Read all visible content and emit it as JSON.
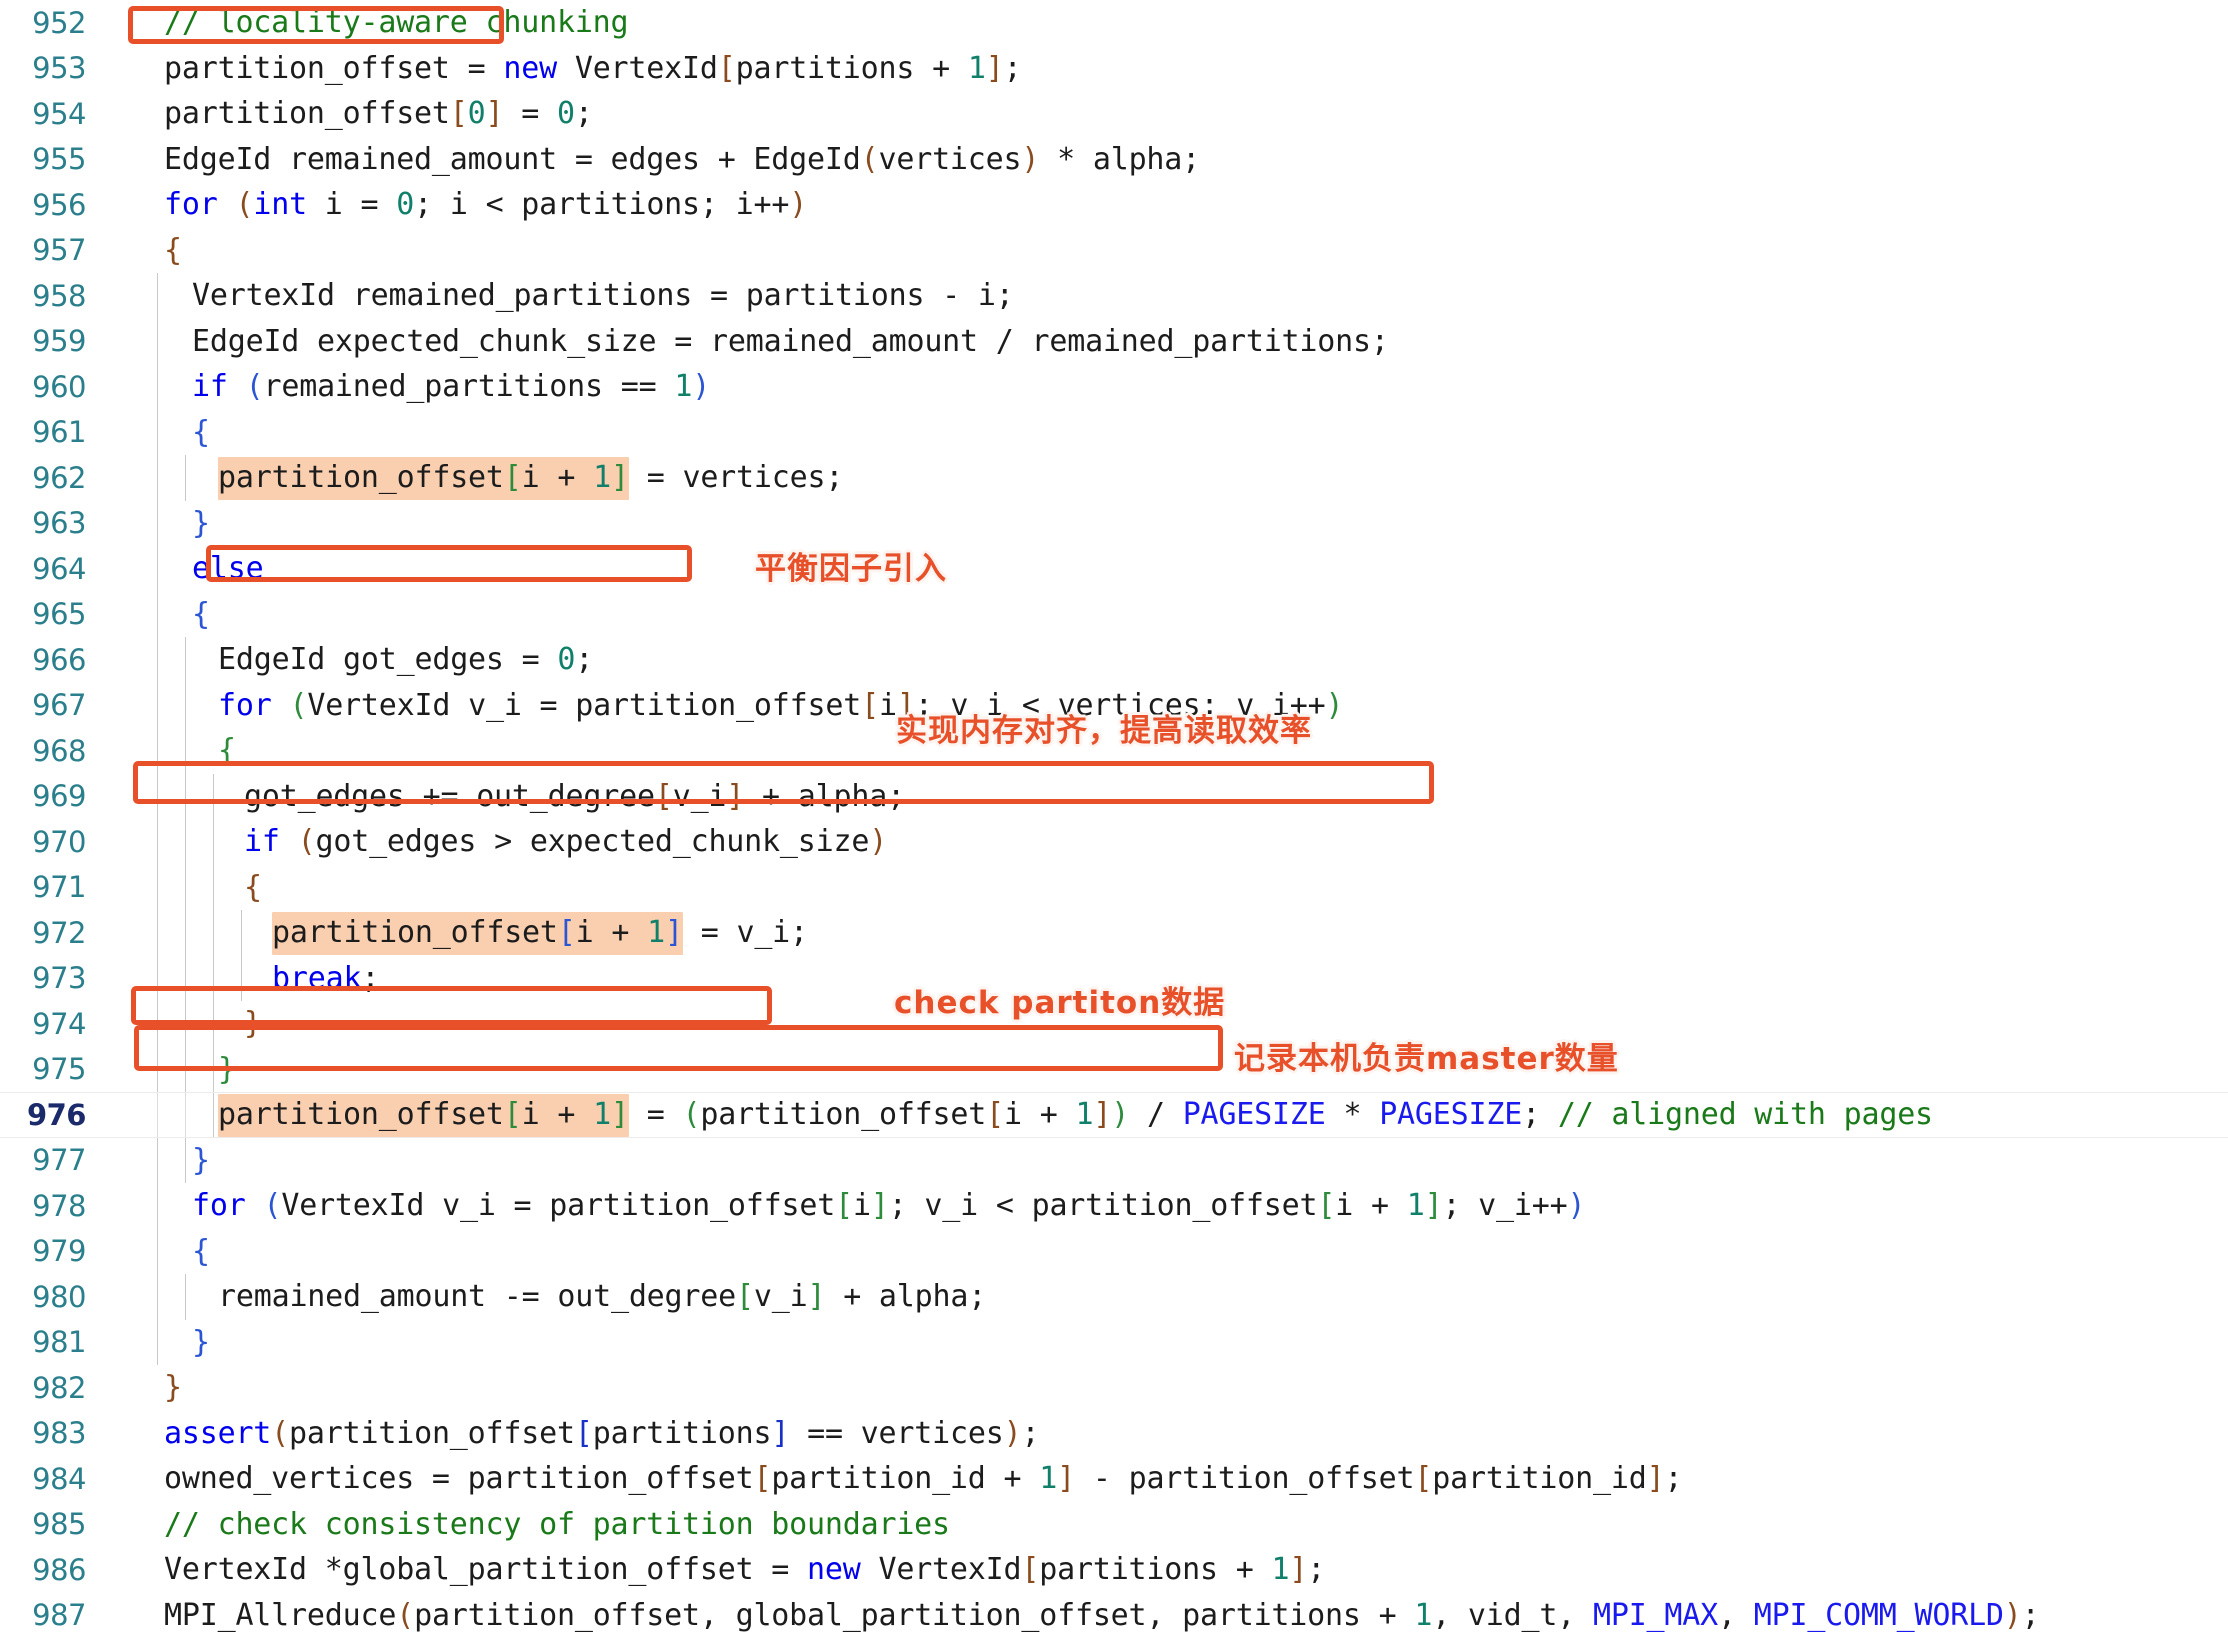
{
  "editor": {
    "language": "cpp",
    "first_line": 952,
    "last_line": 987,
    "active_line": 976,
    "colors": {
      "background": "#ffffff",
      "gutter_text": "#2b7f8c",
      "active_gutter_text": "#1b2a6b",
      "keyword": "#0000ee",
      "comment": "#1a7a1a",
      "number": "#11806a",
      "macro": "#1a1aee",
      "plain_text": "#1c1c1c",
      "occurrence_highlight": "#f9cfb0",
      "annotation_red": "#e8502a",
      "indent_guide": "#c8c8c8"
    }
  },
  "lines": [
    {
      "n": "952",
      "indent": 0
    },
    {
      "n": "953",
      "indent": 0
    },
    {
      "n": "954",
      "indent": 0
    },
    {
      "n": "955",
      "indent": 0
    },
    {
      "n": "956",
      "indent": 0
    },
    {
      "n": "957",
      "indent": 0
    },
    {
      "n": "958",
      "indent": 1
    },
    {
      "n": "959",
      "indent": 1
    },
    {
      "n": "960",
      "indent": 1
    },
    {
      "n": "961",
      "indent": 1
    },
    {
      "n": "962",
      "indent": 2
    },
    {
      "n": "963",
      "indent": 1
    },
    {
      "n": "964",
      "indent": 1
    },
    {
      "n": "965",
      "indent": 1
    },
    {
      "n": "966",
      "indent": 2
    },
    {
      "n": "967",
      "indent": 2
    },
    {
      "n": "968",
      "indent": 2
    },
    {
      "n": "969",
      "indent": 3
    },
    {
      "n": "970",
      "indent": 3
    },
    {
      "n": "971",
      "indent": 3
    },
    {
      "n": "972",
      "indent": 4
    },
    {
      "n": "973",
      "indent": 4
    },
    {
      "n": "974",
      "indent": 3
    },
    {
      "n": "975",
      "indent": 2
    },
    {
      "n": "976",
      "indent": 2
    },
    {
      "n": "977",
      "indent": 1
    },
    {
      "n": "978",
      "indent": 1
    },
    {
      "n": "979",
      "indent": 1
    },
    {
      "n": "980",
      "indent": 2
    },
    {
      "n": "981",
      "indent": 1
    },
    {
      "n": "982",
      "indent": 0
    },
    {
      "n": "983",
      "indent": 0
    },
    {
      "n": "984",
      "indent": 0
    },
    {
      "n": "985",
      "indent": 0
    },
    {
      "n": "986",
      "indent": 0
    },
    {
      "n": "987",
      "indent": 0
    }
  ],
  "code": {
    "l952": "// locality-aware chunking",
    "l953": "partition_offset = new VertexId[partitions + 1];",
    "l954": "partition_offset[0] = 0;",
    "l955": "EdgeId remained_amount = edges + EdgeId(vertices) * alpha;",
    "l956": "for (int i = 0; i < partitions; i++)",
    "l957": "{",
    "l958": "VertexId remained_partitions = partitions - i;",
    "l959": "EdgeId expected_chunk_size = remained_amount / remained_partitions;",
    "l960": "if (remained_partitions == 1)",
    "l961": "{",
    "l962": "partition_offset[i + 1] = vertices;",
    "l963": "}",
    "l964": "else",
    "l965": "{",
    "l966": "EdgeId got_edges = 0;",
    "l967": "for (VertexId v_i = partition_offset[i]; v_i < vertices; v_i++)",
    "l968": "{",
    "l969": "got_edges += out_degree[v_i] + alpha;",
    "l970": "if (got_edges > expected_chunk_size)",
    "l971": "{",
    "l972": "partition_offset[i + 1] = v_i;",
    "l973": "break;",
    "l974": "}",
    "l975": "}",
    "l976": "partition_offset[i + 1] = (partition_offset[i + 1]) / PAGESIZE * PAGESIZE; // aligned with pages",
    "l977": "}",
    "l978": "for (VertexId v_i = partition_offset[i]; v_i < partition_offset[i + 1]; v_i++)",
    "l979": "{",
    "l980": "remained_amount -= out_degree[v_i] + alpha;",
    "l981": "}",
    "l982": "}",
    "l983": "assert(partition_offset[partitions] == vertices);",
    "l984": "owned_vertices = partition_offset[partition_id + 1] - partition_offset[partition_id];",
    "l985": "// check consistency of partition boundaries",
    "l986": "VertexId *global_partition_offset = new VertexId[partitions + 1];",
    "l987": "MPI_Allreduce(partition_offset, global_partition_offset, partitions + 1, vid_t, MPI_MAX, MPI_COMM_WORLD);"
  },
  "annotations": {
    "labels": [
      {
        "id": "balance-factor",
        "text": "平衡因子引入"
      },
      {
        "id": "memory-align",
        "text": "实现内存对齐，提高读取效率"
      },
      {
        "id": "check-partition",
        "text": "check partiton数据"
      },
      {
        "id": "record-master",
        "text": "记录本机负责master数量"
      }
    ],
    "boxes": [
      {
        "id": "box-comment-952",
        "target_line": "952"
      },
      {
        "id": "box-got-edges-969",
        "target_line": "969"
      },
      {
        "id": "box-pagesize-976",
        "target_line": "976"
      },
      {
        "id": "box-assert-983",
        "target_line": "983"
      },
      {
        "id": "box-owned-984",
        "target_line": "984"
      }
    ]
  }
}
